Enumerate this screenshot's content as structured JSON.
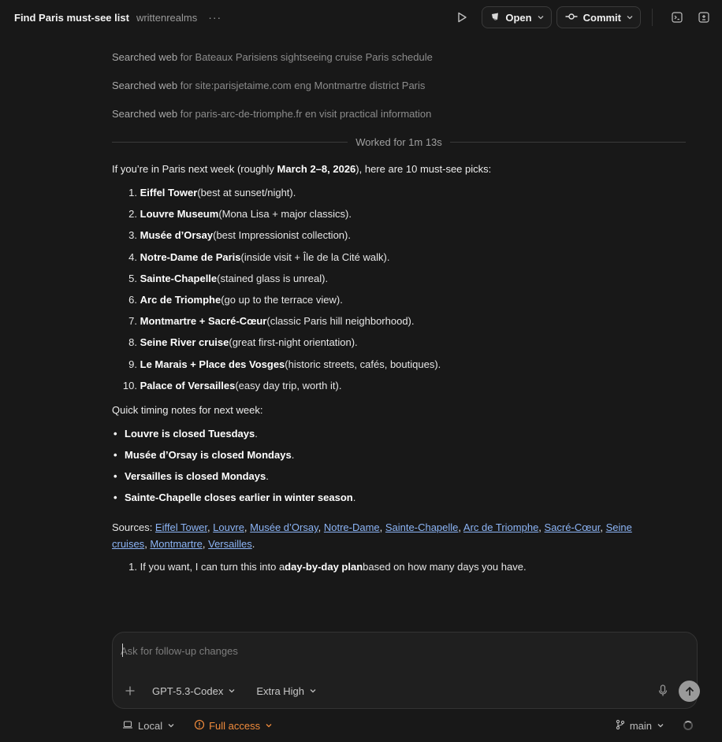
{
  "header": {
    "title": "Find Paris must-see list",
    "project": "writtenrealms",
    "more": "···",
    "open_label": "Open",
    "commit_label": "Commit"
  },
  "searches": [
    {
      "prefix": "Searched web",
      "query": "for Bateaux Parisiens sightseeing cruise Paris schedule"
    },
    {
      "prefix": "Searched web",
      "query": "for site:parisjetaime.com eng Montmartre district Paris"
    },
    {
      "prefix": "Searched web",
      "query": "for paris-arc-de-triomphe.fr en visit practical information"
    }
  ],
  "worked": "Worked for 1m 13s",
  "intro": {
    "pre": "If you’re in Paris next week (roughly ",
    "bold": "March 2–8, 2026",
    "post": "), here are 10 must-see picks:"
  },
  "picks": [
    {
      "num": "1.",
      "name": "Eiffel Tower",
      "note": " (best at sunset/night)."
    },
    {
      "num": "2.",
      "name": "Louvre Museum",
      "note": " (Mona Lisa + major classics)."
    },
    {
      "num": "3.",
      "name": "Musée d’Orsay",
      "note": " (best Impressionist collection)."
    },
    {
      "num": "4.",
      "name": "Notre-Dame de Paris",
      "note": " (inside visit + Île de la Cité walk)."
    },
    {
      "num": "5.",
      "name": "Sainte-Chapelle",
      "note": " (stained glass is unreal)."
    },
    {
      "num": "6.",
      "name": "Arc de Triomphe",
      "note": " (go up to the terrace view)."
    },
    {
      "num": "7.",
      "name": "Montmartre + Sacré-Cœur",
      "note": " (classic Paris hill neighborhood)."
    },
    {
      "num": "8.",
      "name": "Seine River cruise",
      "note": " (great first-night orientation)."
    },
    {
      "num": "9.",
      "name": "Le Marais + Place des Vosges",
      "note": " (historic streets, cafés, boutiques)."
    },
    {
      "num": "10.",
      "name": "Palace of Versailles",
      "note": " (easy day trip, worth it)."
    }
  ],
  "notes_heading": "Quick timing notes for next week:",
  "notes": [
    "Louvre is closed Tuesdays",
    "Musée d’Orsay is closed Mondays",
    "Versailles is closed Mondays",
    "Sainte-Chapelle closes earlier in winter season"
  ],
  "sources": {
    "label": "Sources: ",
    "links": [
      "Eiffel Tower",
      "Louvre",
      "Musée d’Orsay",
      "Notre-Dame",
      "Sainte-Chapelle",
      "Arc de Triomphe",
      "Sacré-Cœur",
      "Seine cruises",
      "Montmartre",
      "Versailles"
    ]
  },
  "followup": {
    "num": "1.",
    "pre": "If you want, I can turn this into a ",
    "bold": "day-by-day plan",
    "post": " based on how many days you have."
  },
  "composer": {
    "placeholder": "Ask for follow-up changes",
    "model": "GPT-5.3-Codex",
    "effort": "Extra High"
  },
  "footer": {
    "env": "Local",
    "access": "Full access",
    "branch": "main"
  },
  "colors": {
    "background": "#181818",
    "link": "#8cb4f5",
    "access_warning": "#f08b3c"
  }
}
